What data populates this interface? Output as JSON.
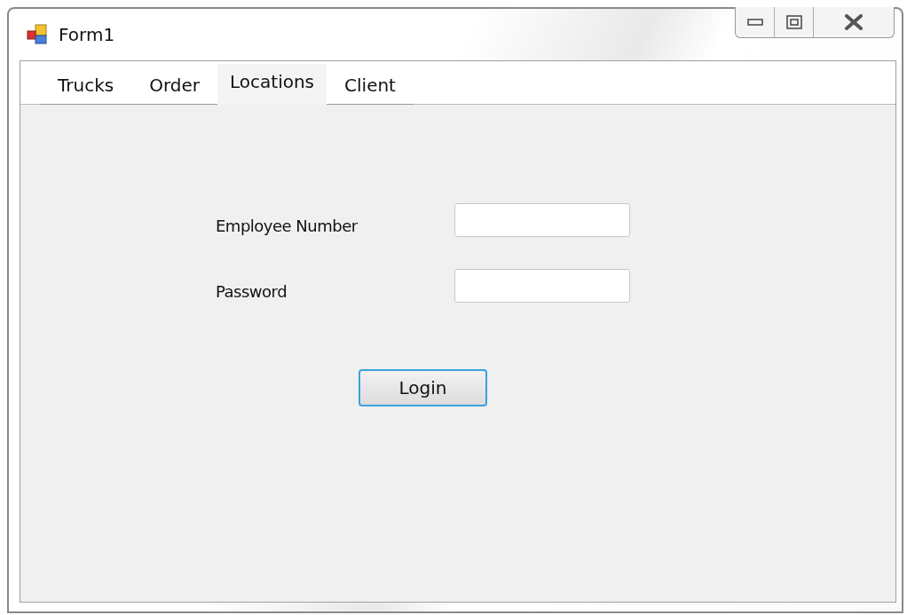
{
  "window": {
    "title": "Form1"
  },
  "tabs": [
    {
      "label": "Trucks",
      "selected": false
    },
    {
      "label": "Order",
      "selected": false
    },
    {
      "label": "Locations",
      "selected": true
    },
    {
      "label": "Client",
      "selected": false
    }
  ],
  "form": {
    "fields": [
      {
        "label": "Employee Number"
      },
      {
        "label": "Password"
      }
    ],
    "button": "Login"
  }
}
